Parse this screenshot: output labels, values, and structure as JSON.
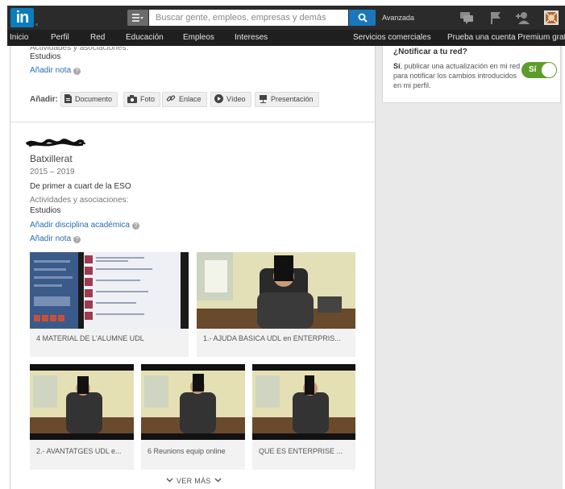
{
  "header": {
    "logo_text": "in",
    "search_placeholder": "Buscar gente, empleos, empresas y demás",
    "advanced_label": "Avanzada",
    "icons": [
      "messages-icon",
      "flag-icon",
      "add-connection-icon",
      "avatar-icon"
    ]
  },
  "nav": {
    "items": [
      "Inicio",
      "Perfil",
      "Red",
      "Educación",
      "Empleos",
      "Intereses"
    ],
    "business": "Servicios comerciales",
    "premium": "Prueba una cuenta Premium gratis"
  },
  "top_entry": {
    "activities_label": "Actividades y asociaciones:",
    "activities_value": "Estudios",
    "add_note": "Añadir nota"
  },
  "attach": {
    "label": "Añadir:",
    "buttons": [
      "Documento",
      "Foto",
      "Enlace",
      "Vídeo",
      "Presentación"
    ]
  },
  "notify": {
    "title": "¿Notificar a tu red?",
    "text_bold": "Sí",
    "text": ", publicar una actualización en mi red para notificar los cambios introducidos en mi perfil.",
    "toggle_label": "Sí"
  },
  "entry": {
    "degree": "Batxillerat",
    "years": "2015 – 2019",
    "description": "De primer a cuart de la ESO",
    "activities_label": "Actividades y asociaciones:",
    "activities_value": "Estudios",
    "add_discipline": "Añadir disciplina académica",
    "add_note": "Añadir nota"
  },
  "media": [
    {
      "caption": "4 MATERIAL DE L'ALUMNE UDL"
    },
    {
      "caption": "1.- AJUDA BASICA UDL en ENTERPRIS..."
    },
    {
      "caption": "2.- AVANTATGES UDL e..."
    },
    {
      "caption": "6 Reunions equip online"
    },
    {
      "caption": "QUE ES ENTERPRISE ..."
    }
  ],
  "see_more": "VER MÁS",
  "colors": {
    "topbar": "#2b2b2b",
    "navbar": "#1f1f1f",
    "link": "#2a6cb0",
    "toggle": "#5d9c2a",
    "logo": "#0a7dbd"
  }
}
